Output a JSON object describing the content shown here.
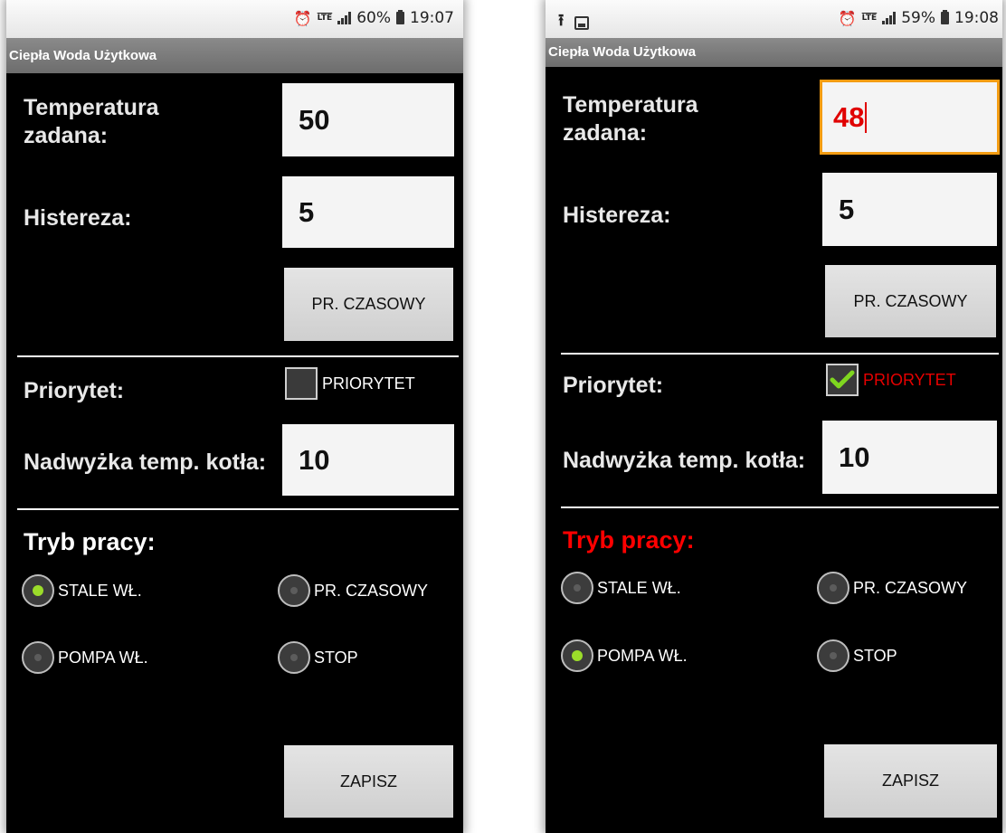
{
  "app_title": "Ciepła Woda Użytkowa",
  "labels": {
    "temperature": "Temperatura zadana:",
    "hysteresis": "Histereza:",
    "priority": "Priorytet:",
    "boiler_excess": "Nadwyżka temp. kotła:",
    "work_mode": "Tryb pracy:"
  },
  "buttons": {
    "schedule": "PR. CZASOWY",
    "save": "ZAPISZ"
  },
  "checkbox_label": "PRIORYTET",
  "modes": {
    "always_on": "STALE WŁ.",
    "schedule": "PR. CZASOWY",
    "pump_on": "POMPA WŁ.",
    "stop": "STOP"
  },
  "left_screen": {
    "status": {
      "battery": "60%",
      "time": "19:07"
    },
    "temperature_value": "50",
    "hysteresis_value": "5",
    "priority_checked": false,
    "boiler_excess_value": "10",
    "selected_mode": "always_on"
  },
  "right_screen": {
    "status": {
      "battery": "59%",
      "time": "19:08"
    },
    "temperature_value": "48",
    "hysteresis_value": "5",
    "priority_checked": true,
    "boiler_excess_value": "10",
    "selected_mode": "pump_on"
  },
  "colors": {
    "focus_border": "#f39c12",
    "alert_red": "#ff0000",
    "radio_selected": "#9bdc2a"
  },
  "icons": [
    "alarm-icon",
    "lte-icon",
    "signal-icon",
    "battery-icon",
    "upload-icon",
    "image-icon",
    "checkmark-icon"
  ]
}
